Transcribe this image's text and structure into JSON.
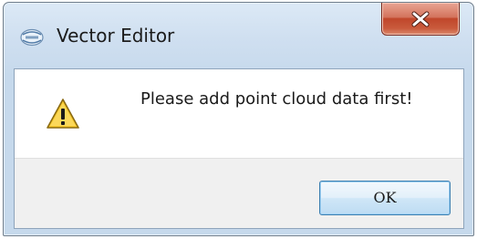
{
  "window": {
    "title": "Vector Editor",
    "app_icon": "app-logo-icon",
    "close_icon": "close-icon"
  },
  "dialog": {
    "icon": "warning-icon",
    "message": "Please add point cloud data first!",
    "ok_label": "OK"
  },
  "colors": {
    "close_button": "#c9553a",
    "ok_border": "#3c7fb1",
    "titlebar": "#cfdff0",
    "warning_yellow": "#f7c82b"
  }
}
